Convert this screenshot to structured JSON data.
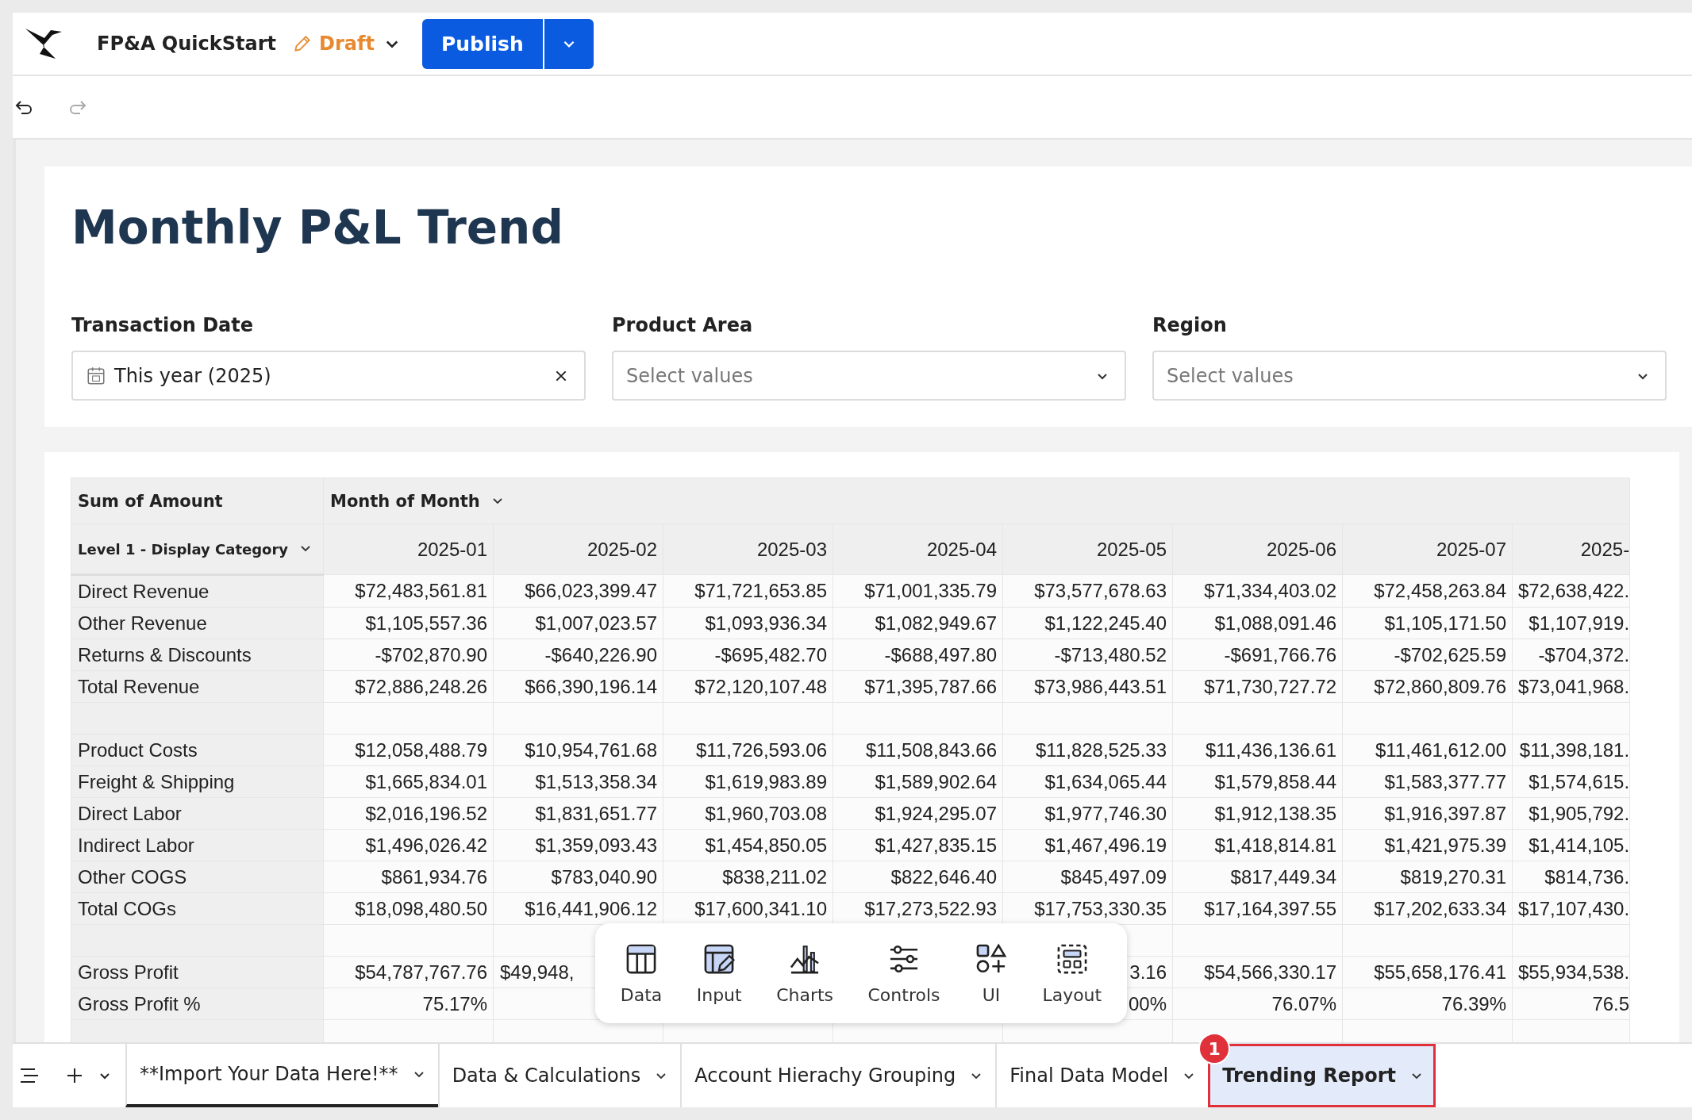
{
  "header": {
    "app_name": "FP&A QuickStart",
    "status": "Draft",
    "publish_label": "Publish"
  },
  "page_title": "Monthly P&L Trend",
  "filters": [
    {
      "kind": "date",
      "label": "Transaction Date",
      "value": "This year (2025)"
    },
    {
      "kind": "select",
      "label": "Product Area",
      "placeholder": "Select values"
    },
    {
      "kind": "select",
      "label": "Region",
      "placeholder": "Select values"
    }
  ],
  "table": {
    "corner": "Sum of Amount",
    "column_group": "Month of Month",
    "row_header": "Level 1 - Display Category",
    "columns": [
      "2025-01",
      "2025-02",
      "2025-03",
      "2025-04",
      "2025-05",
      "2025-06",
      "2025-07",
      "2025-"
    ],
    "rows": [
      {
        "kind": "data",
        "label": "Direct Revenue",
        "cells": [
          "$72,483,561.81",
          "$66,023,399.47",
          "$71,721,653.85",
          "$71,001,335.79",
          "$73,577,678.63",
          "$71,334,403.02",
          "$72,458,263.84",
          "$72,638,422."
        ]
      },
      {
        "kind": "data",
        "label": "Other Revenue",
        "cells": [
          "$1,105,557.36",
          "$1,007,023.57",
          "$1,093,936.34",
          "$1,082,949.67",
          "$1,122,245.40",
          "$1,088,091.46",
          "$1,105,171.50",
          "$1,107,919."
        ]
      },
      {
        "kind": "data",
        "label": "Returns & Discounts",
        "cells": [
          "-$702,870.90",
          "-$640,226.90",
          "-$695,482.70",
          "-$688,497.80",
          "-$713,480.52",
          "-$691,766.76",
          "-$702,625.59",
          "-$704,372."
        ]
      },
      {
        "kind": "data",
        "label": "Total Revenue",
        "cells": [
          "$72,886,248.26",
          "$66,390,196.14",
          "$72,120,107.48",
          "$71,395,787.66",
          "$73,986,443.51",
          "$71,730,727.72",
          "$72,860,809.76",
          "$73,041,968."
        ]
      },
      {
        "kind": "spacer"
      },
      {
        "kind": "data",
        "label": "Product Costs",
        "cells": [
          "$12,058,488.79",
          "$10,954,761.68",
          "$11,726,593.06",
          "$11,508,843.66",
          "$11,828,525.33",
          "$11,436,136.61",
          "$11,461,612.00",
          "$11,398,181."
        ]
      },
      {
        "kind": "data",
        "label": "Freight & Shipping",
        "cells": [
          "$1,665,834.01",
          "$1,513,358.34",
          "$1,619,983.89",
          "$1,589,902.64",
          "$1,634,065.44",
          "$1,579,858.44",
          "$1,583,377.77",
          "$1,574,615."
        ]
      },
      {
        "kind": "data",
        "label": "Direct Labor",
        "cells": [
          "$2,016,196.52",
          "$1,831,651.77",
          "$1,960,703.08",
          "$1,924,295.07",
          "$1,977,746.30",
          "$1,912,138.35",
          "$1,916,397.87",
          "$1,905,792."
        ]
      },
      {
        "kind": "data",
        "label": "Indirect Labor",
        "cells": [
          "$1,496,026.42",
          "$1,359,093.43",
          "$1,454,850.05",
          "$1,427,835.15",
          "$1,467,496.19",
          "$1,418,814.81",
          "$1,421,975.39",
          "$1,414,105."
        ]
      },
      {
        "kind": "data",
        "label": "Other COGS",
        "cells": [
          "$861,934.76",
          "$783,040.90",
          "$838,211.02",
          "$822,646.40",
          "$845,497.09",
          "$817,449.34",
          "$819,270.31",
          "$814,736."
        ]
      },
      {
        "kind": "data",
        "label": "Total COGs",
        "cells": [
          "$18,098,480.50",
          "$16,441,906.12",
          "$17,600,341.10",
          "$17,273,522.93",
          "$17,753,330.35",
          "$17,164,397.55",
          "$17,202,633.34",
          "$17,107,430."
        ]
      },
      {
        "kind": "spacer"
      },
      {
        "kind": "data",
        "label": "Gross Profit",
        "cells": [
          "$54,787,767.76",
          {
            "text": "$49,948,",
            "cut": true
          },
          null,
          null,
          "3.16",
          "$54,566,330.17",
          "$55,658,176.41",
          "$55,934,538."
        ]
      },
      {
        "kind": "data",
        "label": "Gross Profit %",
        "cells": [
          "75.17%",
          null,
          null,
          null,
          "00%",
          "76.07%",
          "76.39%",
          "76.5"
        ]
      },
      {
        "kind": "spacer"
      }
    ]
  },
  "add_menu": [
    {
      "kind": "data",
      "label": "Data"
    },
    {
      "kind": "input",
      "label": "Input"
    },
    {
      "kind": "charts",
      "label": "Charts"
    },
    {
      "kind": "controls",
      "label": "Controls"
    },
    {
      "kind": "ui",
      "label": "UI"
    },
    {
      "kind": "layout",
      "label": "Layout"
    }
  ],
  "page_tabs": [
    {
      "label": "**Import Your Data Here!**",
      "selected": false
    },
    {
      "label": "Data & Calculations",
      "selected": false
    },
    {
      "label": "Account Hierachy Grouping",
      "selected": false
    },
    {
      "label": "Final Data Model",
      "selected": false
    },
    {
      "label": "Trending Report",
      "selected": true,
      "badge": "1"
    }
  ]
}
